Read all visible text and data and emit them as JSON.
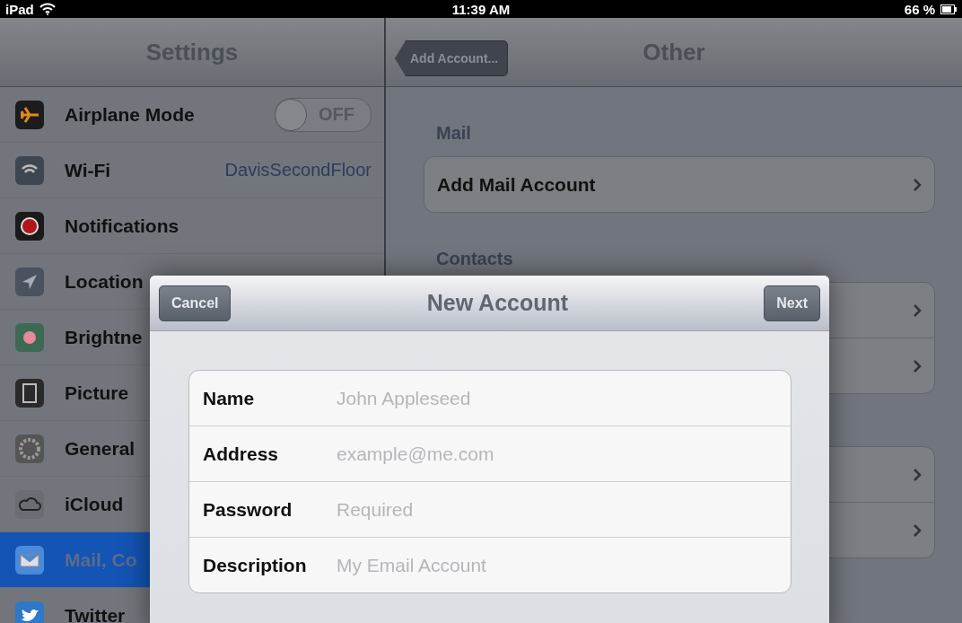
{
  "status_bar": {
    "device": "iPad",
    "time": "11:39 AM",
    "battery": "66 %"
  },
  "sidebar": {
    "title": "Settings",
    "items": [
      {
        "label": "Airplane Mode",
        "kind": "toggle",
        "toggle": {
          "on": false,
          "text": "OFF"
        },
        "selected": false
      },
      {
        "label": "Wi-Fi",
        "kind": "value",
        "value": "DavisSecondFloor",
        "selected": false
      },
      {
        "label": "Notifications",
        "kind": "plain",
        "selected": false
      },
      {
        "label": "Location",
        "kind": "plain",
        "selected": false
      },
      {
        "label": "Brightne",
        "kind": "plain",
        "selected": false
      },
      {
        "label": "Picture",
        "kind": "plain",
        "selected": false
      },
      {
        "label": "General",
        "kind": "plain",
        "selected": false
      },
      {
        "label": "iCloud",
        "kind": "plain",
        "selected": false
      },
      {
        "label": "Mail, Co",
        "kind": "plain",
        "selected": true
      },
      {
        "label": "Twitter",
        "kind": "plain",
        "selected": false
      }
    ]
  },
  "detail": {
    "back_button": "Add Account...",
    "title": "Other",
    "groups": [
      {
        "heading": "Mail",
        "rows": [
          {
            "label": "Add Mail Account"
          }
        ]
      },
      {
        "heading": "Contacts",
        "rows": [
          {},
          {}
        ]
      },
      {
        "rows": [
          {},
          {}
        ]
      }
    ]
  },
  "dialog": {
    "cancel": "Cancel",
    "title": "New Account",
    "next": "Next",
    "fields": [
      {
        "label": "Name",
        "placeholder": "John Appleseed"
      },
      {
        "label": "Address",
        "placeholder": "example@me.com"
      },
      {
        "label": "Password",
        "placeholder": "Required"
      },
      {
        "label": "Description",
        "placeholder": "My Email Account"
      }
    ]
  }
}
